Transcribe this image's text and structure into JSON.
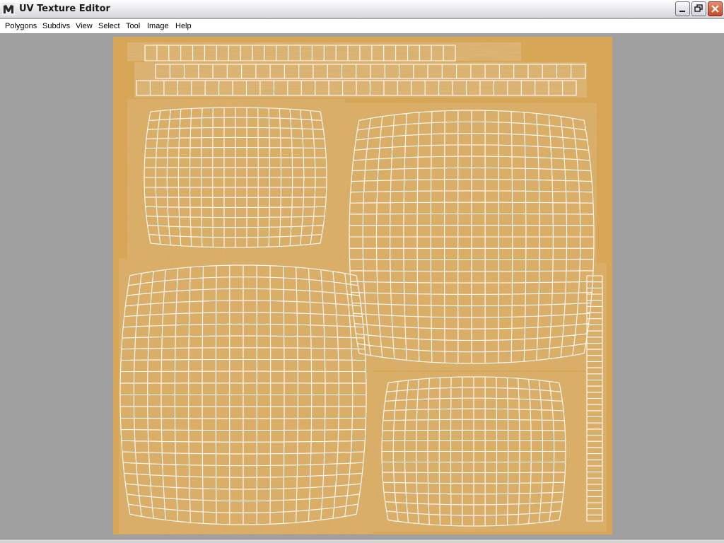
{
  "window": {
    "title": "UV Texture Editor",
    "icon": "maya-app-icon"
  },
  "window_controls": {
    "minimize": "minimize-icon",
    "restore": "restore-icon",
    "close": "close-icon"
  },
  "menu": {
    "items": [
      {
        "label": "Polygons"
      },
      {
        "label": "Subdivs"
      },
      {
        "label": "View"
      },
      {
        "label": "Select"
      },
      {
        "label": "Tool"
      },
      {
        "label": "Image"
      },
      {
        "label": "Help"
      }
    ]
  },
  "colors": {
    "viewport_bg": "#a0a0a0",
    "texture_base": "#d8a657",
    "wireframe": "#ffffff"
  }
}
